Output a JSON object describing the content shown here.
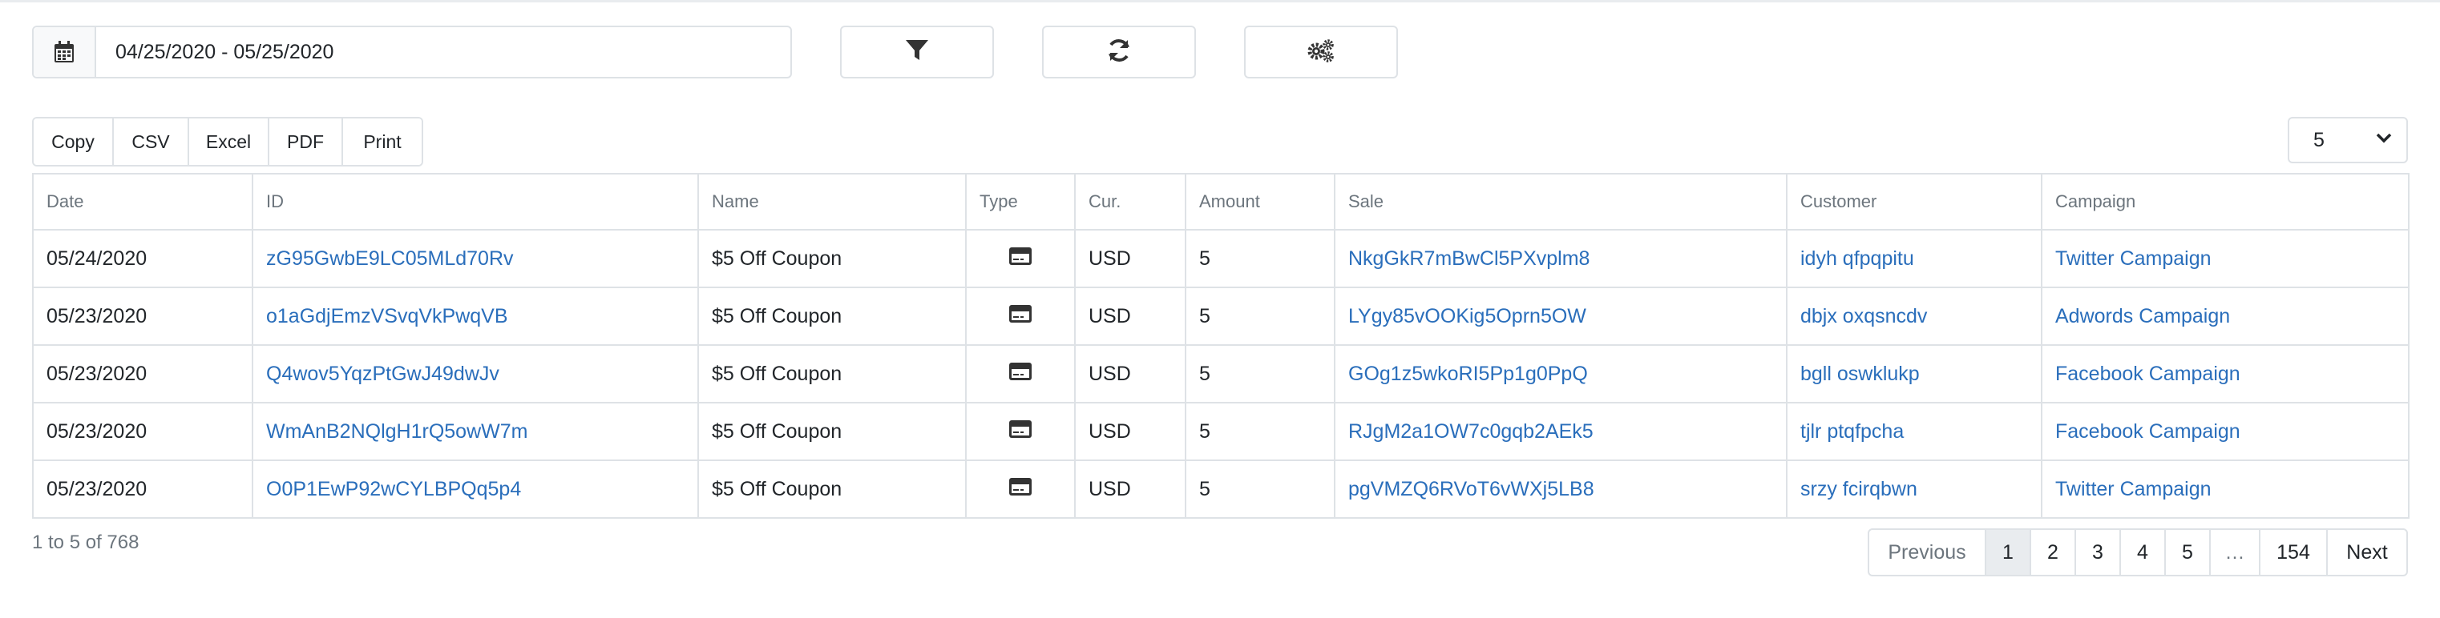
{
  "toolbar": {
    "date_range": "04/25/2020 - 05/25/2020",
    "icons": {
      "calendar": "calendar-icon",
      "filter": "filter-icon",
      "refresh": "refresh-icon",
      "settings": "gears-icon"
    }
  },
  "exports": {
    "copy": "Copy",
    "csv": "CSV",
    "excel": "Excel",
    "pdf": "PDF",
    "print": "Print"
  },
  "page_size": "5",
  "table": {
    "columns": [
      "Date",
      "ID",
      "Name",
      "Type",
      "Cur.",
      "Amount",
      "Sale",
      "Customer",
      "Campaign"
    ],
    "rows": [
      {
        "date": "05/24/2020",
        "id": "zG95GwbE9LC05MLd70Rv",
        "name": "$5 Off Coupon",
        "type": "card-icon",
        "cur": "USD",
        "amount": "5",
        "sale": "NkgGkR7mBwCl5PXvplm8",
        "customer": "idyh qfpqpitu",
        "campaign": "Twitter Campaign"
      },
      {
        "date": "05/23/2020",
        "id": "o1aGdjEmzVSvqVkPwqVB",
        "name": "$5 Off Coupon",
        "type": "card-icon",
        "cur": "USD",
        "amount": "5",
        "sale": "LYgy85vOOKig5Oprn5OW",
        "customer": "dbjx oxqsncdv",
        "campaign": "Adwords Campaign"
      },
      {
        "date": "05/23/2020",
        "id": "Q4wov5YqzPtGwJ49dwJv",
        "name": "$5 Off Coupon",
        "type": "card-icon",
        "cur": "USD",
        "amount": "5",
        "sale": "GOg1z5wkoRI5Pp1g0PpQ",
        "customer": "bgll oswklukp",
        "campaign": "Facebook Campaign"
      },
      {
        "date": "05/23/2020",
        "id": "WmAnB2NQlgH1rQ5owW7m",
        "name": "$5 Off Coupon",
        "type": "card-icon",
        "cur": "USD",
        "amount": "5",
        "sale": "RJgM2a1OW7c0gqb2AEk5",
        "customer": "tjlr ptqfpcha",
        "campaign": "Facebook Campaign"
      },
      {
        "date": "05/23/2020",
        "id": "O0P1EwP92wCYLBPQq5p4",
        "name": "$5 Off Coupon",
        "type": "card-icon",
        "cur": "USD",
        "amount": "5",
        "sale": "pgVMZQ6RVoT6vWXj5LB8",
        "customer": "srzy fcirqbwn",
        "campaign": "Twitter Campaign"
      }
    ]
  },
  "footer": {
    "info": "1 to 5 of 768",
    "pagination": [
      "Previous",
      "1",
      "2",
      "3",
      "4",
      "5",
      "…",
      "154",
      "Next"
    ],
    "active_page": "1"
  },
  "colors": {
    "link": "#2a6ebb",
    "border": "#dee2e6",
    "muted": "#6c757d",
    "active_bg": "#e9ecef"
  }
}
